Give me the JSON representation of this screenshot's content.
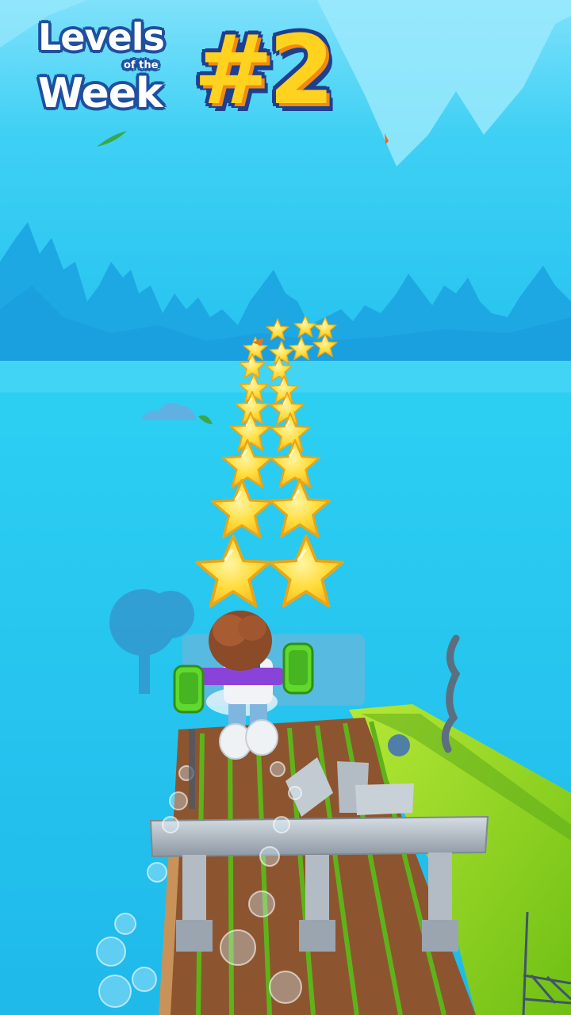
{
  "title": {
    "line1": "Levels",
    "small": "of the",
    "line2": "Week",
    "number": "#2"
  },
  "colors": {
    "sky_top": "#8ee6fb",
    "sky_mid": "#34cdf2",
    "water": "#22c4f0",
    "trees": "#1fa6e3",
    "star_fill": "#ffd83a",
    "star_edge": "#f6b81b",
    "grass": "#8ed21e",
    "soil": "#8a5a34",
    "stone": "#a9b3bd",
    "title_fill": "#ffffff",
    "title_outline": "#1f4f9e",
    "number_fill": "#ffd21f"
  },
  "icons": [
    "star-icon",
    "character-avatar",
    "jetpack-icon",
    "bubble-icon"
  ]
}
